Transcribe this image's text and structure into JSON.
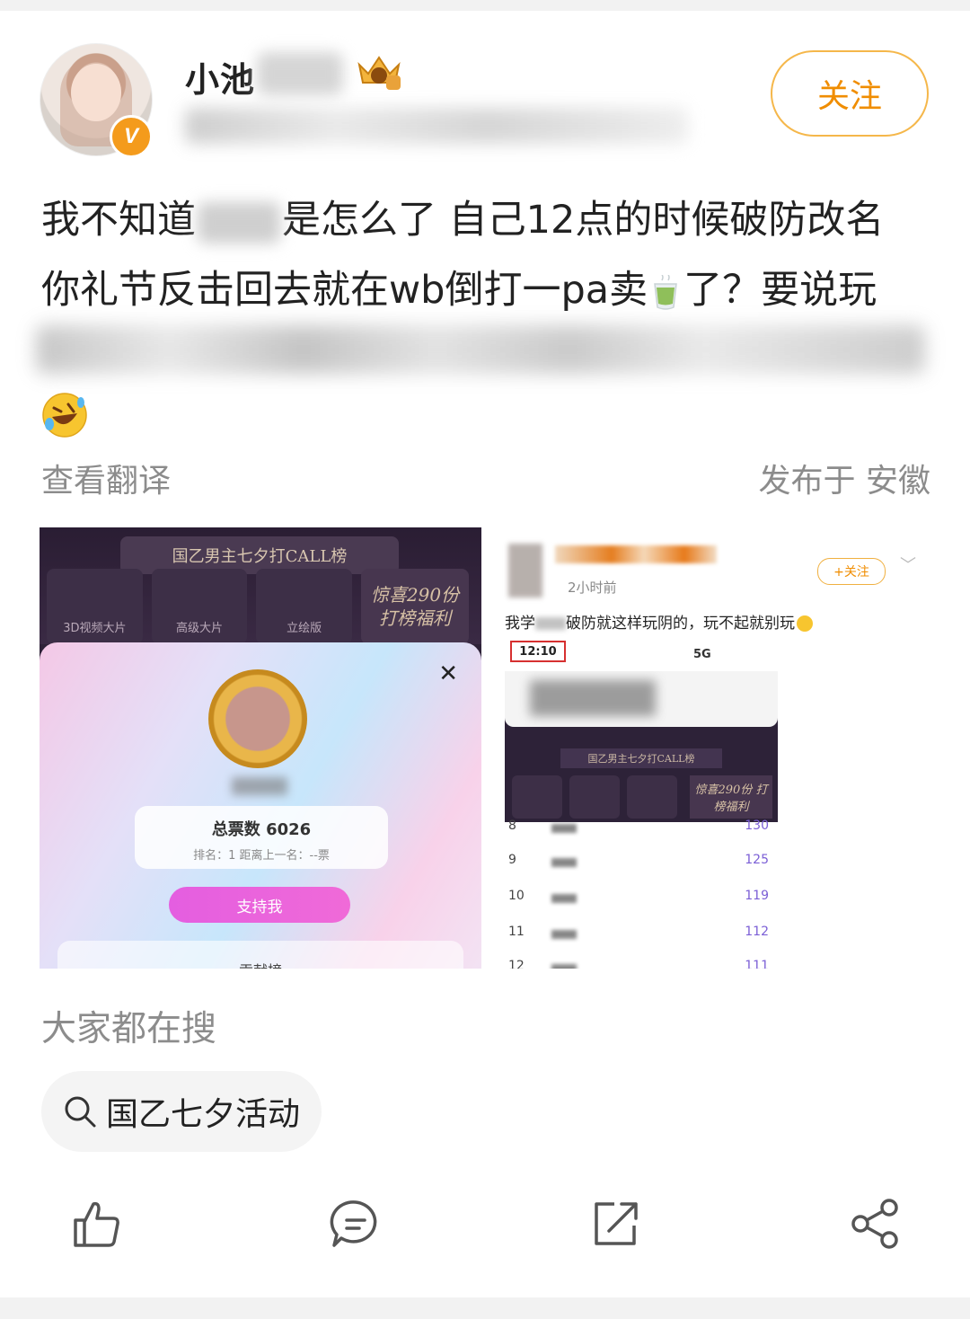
{
  "user": {
    "name": "小池",
    "verified_badge": "V",
    "follow_label": "关注"
  },
  "post": {
    "line1_prefix": "我不知道",
    "line1_suffix": "是怎么了 自己12点的时候破防改名",
    "line2_prefix": "你礼节反击回去就在wb倒打一pa卖",
    "line2_suffix": "了？要说玩",
    "cup_icon": "green-tea-cup-icon",
    "emoji": "rolling-laughing-emoji-icon",
    "translate_label": "查看翻译",
    "location": "发布于 安徽"
  },
  "image_left": {
    "banner": "国乙男主七夕打CALL榜",
    "tiles": [
      "3D视频大片",
      "高级大片",
      "立绘版"
    ],
    "promo": "惊喜290份 打榜福利",
    "total_votes": "总票数 6026",
    "rank_line": "排名：1   距离上一名：--票",
    "support_label": "支持我",
    "contrib_label": "贡献榜"
  },
  "image_right": {
    "time_ago": "2小时前",
    "follow_label": "+关注",
    "text_prefix": "我学",
    "text_suffix": "破防就这样玩阴的，玩不起就别玩",
    "clock": "12:10",
    "signal": "5G",
    "screenshot_banner": "国乙男主七夕打CALL榜",
    "screenshot_promo": "惊喜290份 打榜福利",
    "rows": [
      {
        "rank": "8",
        "votes": "130"
      },
      {
        "rank": "9",
        "votes": "125"
      },
      {
        "rank": "10",
        "votes": "119"
      },
      {
        "rank": "11",
        "votes": "112"
      },
      {
        "rank": "12",
        "votes": "111"
      }
    ]
  },
  "search": {
    "heading": "大家都在搜",
    "chip_text": "国乙七夕活动"
  },
  "actions": {
    "like": "thumbs-up-icon",
    "comment": "comment-bubble-icon",
    "repost": "repost-icon",
    "share": "share-icon"
  },
  "colors": {
    "accent": "#f08d00",
    "muted_text": "#8c8c8c",
    "verified": "#f49b1c"
  }
}
